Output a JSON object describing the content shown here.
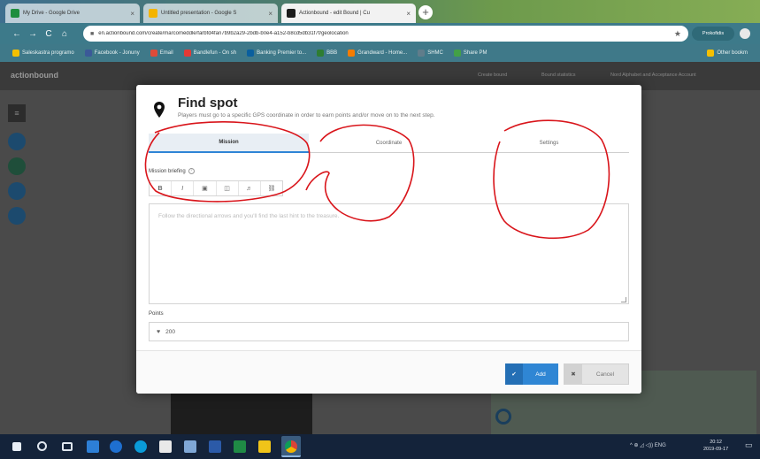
{
  "browser": {
    "tabs": [
      {
        "title": "My Drive - Google Drive",
        "fav_color": "#1e8e3e"
      },
      {
        "title": "Untitled presentation - Google S",
        "fav_color": "#f4b400"
      },
      {
        "title": "Actionbound - edit Bound | Cu",
        "fav_color": "#1b1b1b"
      }
    ],
    "tab_close": "×",
    "newtab": "+",
    "url": "en.actionbound.com/create/marcomeddle/farbfd4fan7b9b2a29-2bdb-b0e4-a152-b8cd5db31f7f/geolocation",
    "profile_label": "Prokofidis",
    "nav": {
      "back": "←",
      "forward": "→",
      "reload": "C",
      "home": "⌂"
    }
  },
  "bookmarks": [
    {
      "label": "Saleskastra programo",
      "color": "#f5c000"
    },
    {
      "label": "Facebook - Jonuny",
      "color": "#3b5998"
    },
    {
      "label": "Email",
      "color": "#dd4b39"
    },
    {
      "label": "Bandlefun - On sh",
      "color": "#e53935"
    },
    {
      "label": "Banking Premier to...",
      "color": "#0a5f9e"
    },
    {
      "label": "BBB",
      "color": "#2e7d32"
    },
    {
      "label": "Grandward - Home...",
      "color": "#f57c00"
    },
    {
      "label": "SHMC",
      "color": "#607d8b"
    },
    {
      "label": "Share PM",
      "color": "#43a047"
    },
    {
      "label": "Other bookm",
      "color": "#f5c000"
    }
  ],
  "app": {
    "brand": "actionbound",
    "topnav": [
      "Create bound",
      "Bound statistics",
      "Nord Alphabet and Acceptance Account"
    ]
  },
  "modal": {
    "title": "Find spot",
    "subtitle": "Players must go to a specific GPS coordinate in order to earn points and/or move on to the next step.",
    "tabs": [
      {
        "label": "Mission",
        "active": true
      },
      {
        "label": "Coordinate",
        "active": false
      },
      {
        "label": "Settings",
        "active": false
      }
    ],
    "briefing_label": "Mission briefing",
    "help_icon": "?",
    "toolbar": {
      "bold": "B",
      "italic": "I",
      "image": "▣",
      "video": "◫",
      "audio": "♬",
      "link": "⛓"
    },
    "briefing_placeholder": "Follow the directional arrows and you'll find the last hint to the treasure.",
    "points_label": "Points",
    "points_icon": "♥",
    "points_value": "200",
    "add_label": "Add",
    "add_icon": "✔",
    "cancel_label": "Cancel",
    "cancel_icon": "✖"
  },
  "annotation_color": "#d9151b",
  "taskbar": {
    "tray": "^  ⊕  ◿  ◁))  ENG",
    "time": "20:12",
    "date": "2019-09-17"
  }
}
